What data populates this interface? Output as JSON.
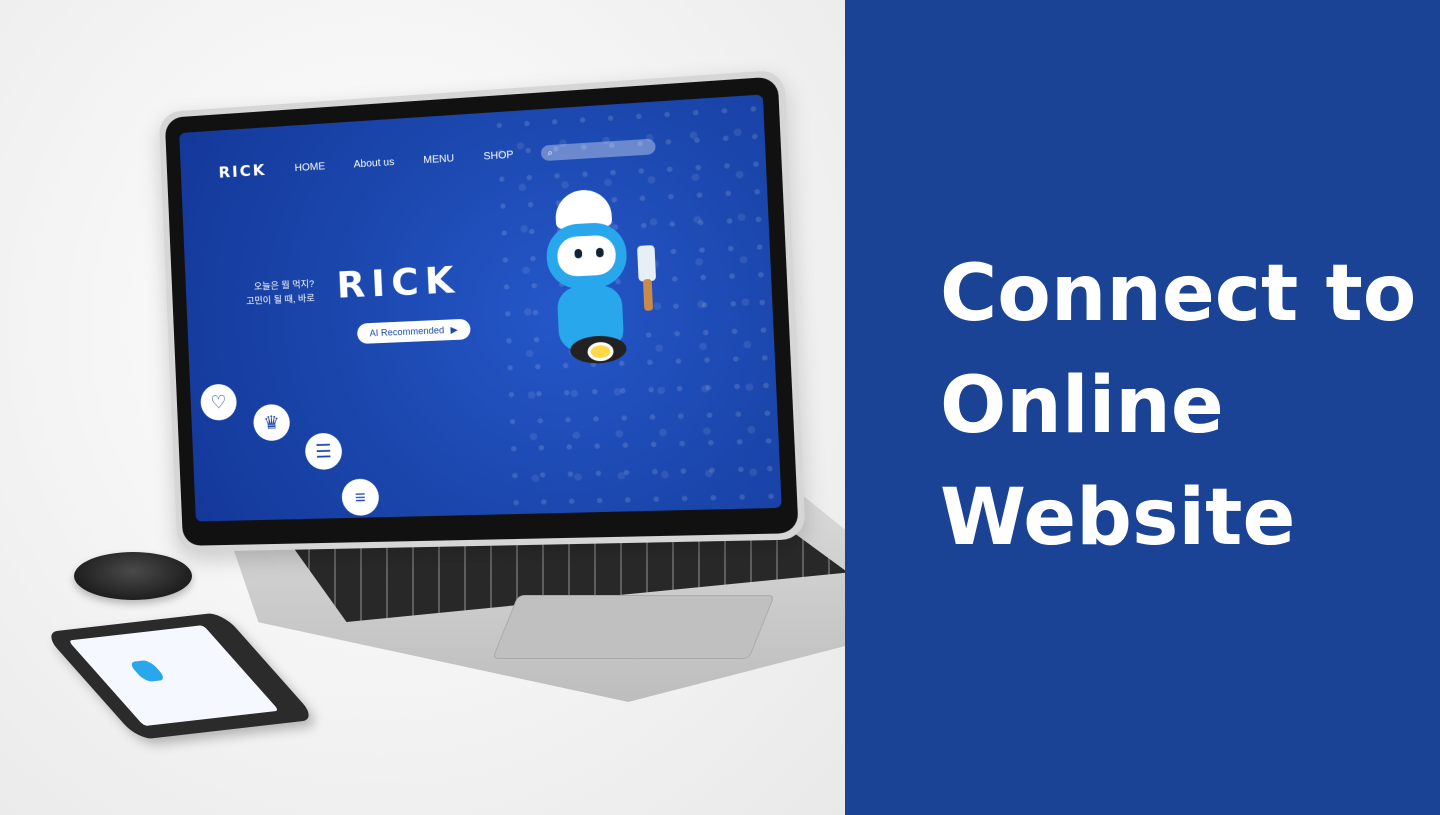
{
  "headline": {
    "lines": [
      "Connect to",
      "Online",
      "Website"
    ]
  },
  "colors": {
    "panel_blue": "#1a4396",
    "screen_blue": "#1b47ad",
    "robot_blue": "#29a7ec"
  },
  "website": {
    "logo": "RICK",
    "nav": {
      "home": "HOME",
      "about": "About us",
      "menu": "MENU",
      "shop": "SHOP"
    },
    "hero": {
      "tagline_1": "오늘은 뭘 먹지?",
      "tagline_2": "고민이 될 때, 바로",
      "logo": "RICK",
      "cta_label": "AI Recommended",
      "cta_arrow": "▶"
    },
    "icons": {
      "search": "⌕",
      "heart": "♡",
      "chef_hat": "♛",
      "chat": "☰",
      "list": "≡"
    }
  }
}
